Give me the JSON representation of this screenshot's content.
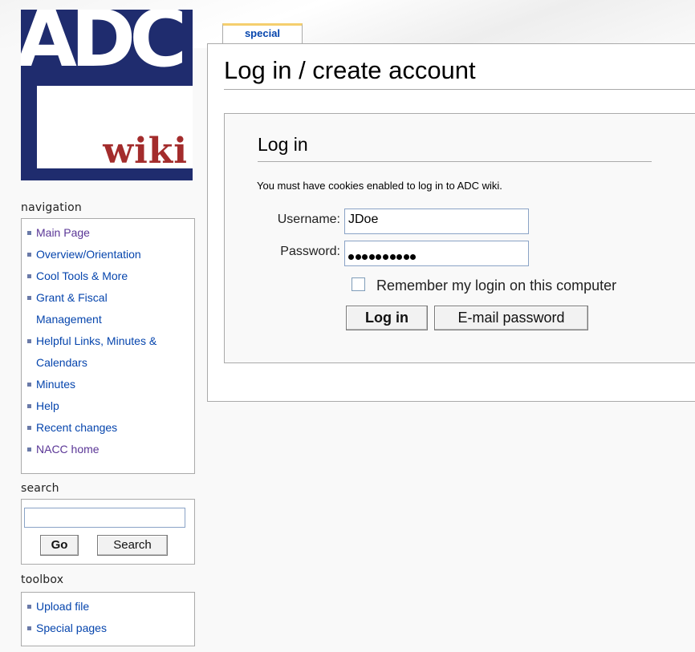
{
  "logo": {
    "letters": "ADC",
    "subtext": "wiki"
  },
  "navigation": {
    "title": "navigation",
    "items": [
      {
        "label": "Main Page"
      },
      {
        "label": "Overview/Orientation"
      },
      {
        "label": "Cool Tools & More"
      },
      {
        "label": "Grant & Fiscal Management"
      },
      {
        "label": "Helpful Links, Minutes & Calendars"
      },
      {
        "label": "Minutes"
      },
      {
        "label": "Help"
      },
      {
        "label": "Recent changes"
      },
      {
        "label": "NACC home"
      }
    ]
  },
  "search": {
    "title": "search",
    "value": "",
    "go_label": "Go",
    "search_label": "Search"
  },
  "toolbox": {
    "title": "toolbox",
    "items": [
      {
        "label": "Upload file"
      },
      {
        "label": "Special pages"
      }
    ]
  },
  "tab": {
    "label": "special"
  },
  "page": {
    "title": "Log in / create account"
  },
  "login": {
    "title": "Log in",
    "cookie_message": "You must have cookies enabled to log in to ADC wiki.",
    "username_label": "Username:",
    "username_value": "JDoe",
    "password_label": "Password:",
    "password_mask_length": 10,
    "remember_label": "Remember my login on this computer",
    "remember_checked": false,
    "login_button": "Log in",
    "email_button": "E-mail password"
  },
  "colors": {
    "link": "#0645ad",
    "visited": "#5a3696",
    "logo_bg": "#1f2c6e",
    "logo_wiki": "#a32c2c",
    "tab_accent": "#f5cf6e"
  }
}
